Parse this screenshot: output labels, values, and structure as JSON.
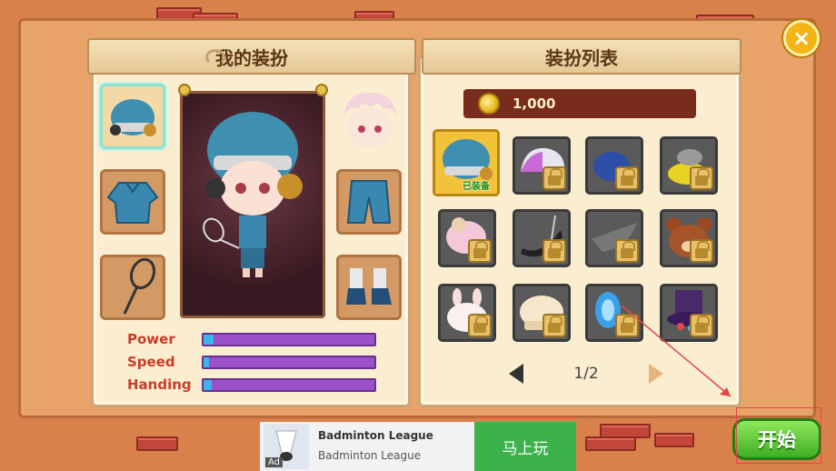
{
  "left_panel": {
    "title": "我的装扮",
    "stats": [
      {
        "label": "Power",
        "value": 0.06
      },
      {
        "label": "Speed",
        "value": 0.03
      },
      {
        "label": "Handing",
        "value": 0.05
      }
    ]
  },
  "right_panel": {
    "title": "装扮列表",
    "coins": "1,000",
    "equipped_tag": "已装备",
    "pagination": "1/2"
  },
  "ad": {
    "title": "Badminton League",
    "subtitle": "Badminton League",
    "cta": "马上玩",
    "badge": "Ad"
  },
  "start_button": "开始",
  "close_icon": "×"
}
